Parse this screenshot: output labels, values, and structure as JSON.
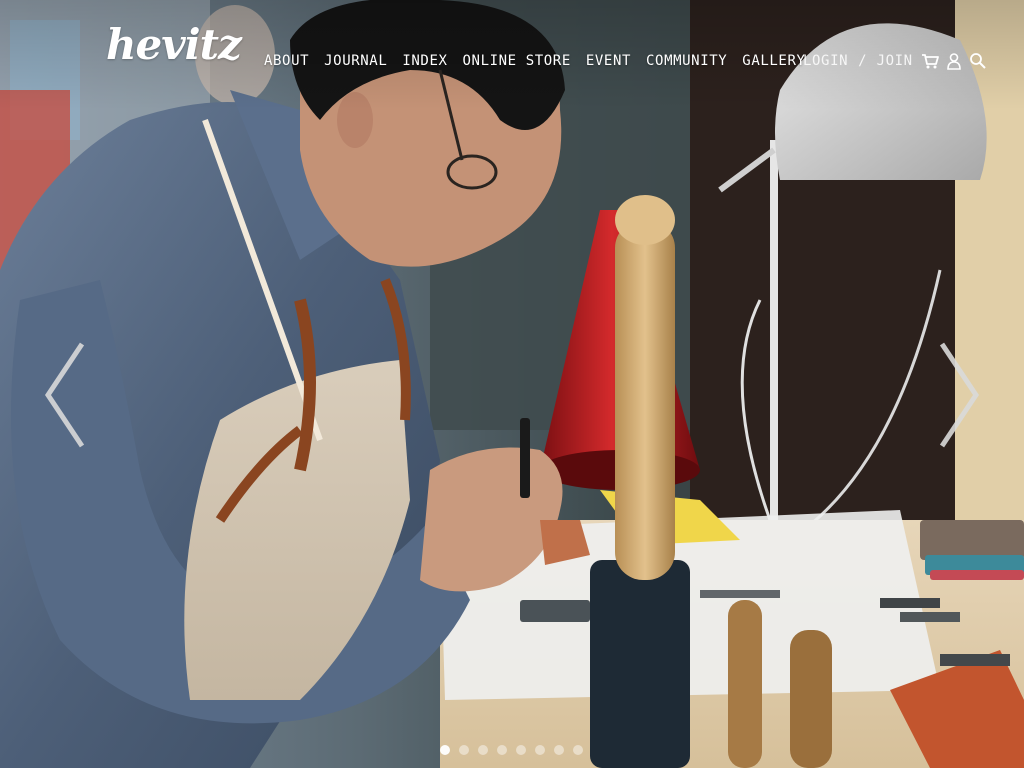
{
  "brand": {
    "logo_text": "hevitz"
  },
  "nav": {
    "items": [
      {
        "label": "ABOUT"
      },
      {
        "label": "JOURNAL"
      },
      {
        "label": "INDEX"
      },
      {
        "label": "ONLINE STORE"
      },
      {
        "label": "EVENT"
      },
      {
        "label": "COMMUNITY"
      },
      {
        "label": "GALLERY"
      }
    ],
    "login_label": "LOGIN",
    "separator": "/",
    "join_label": "JOIN",
    "icons": [
      "cart-icon",
      "user-icon",
      "search-icon"
    ]
  },
  "slider": {
    "image_subject": "leather-craftsman-at-workbench",
    "prev_icon": "chevron-left-icon",
    "next_icon": "chevron-right-icon",
    "slide_count": 8,
    "active_index": 0
  },
  "colors": {
    "nav_text": "#ffffff",
    "arrow": "#d9d9d9"
  }
}
